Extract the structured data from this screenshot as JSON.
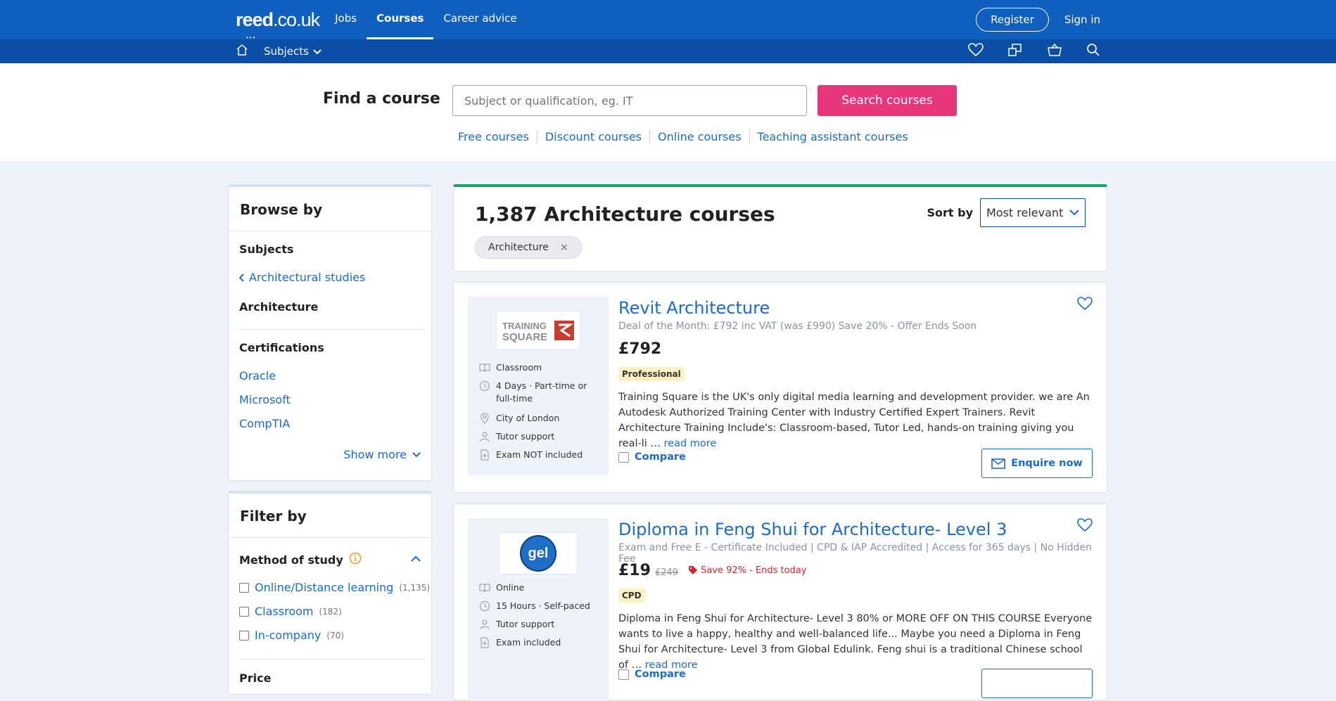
{
  "header": {
    "logo": "reed.co.uk",
    "nav": [
      "Jobs",
      "Courses",
      "Career advice"
    ],
    "register": "Register",
    "signin": "Sign in"
  },
  "subnav": {
    "subjects": "Subjects"
  },
  "search": {
    "label": "Find a course",
    "placeholder": "Subject or qualification, eg. IT",
    "button": "Search courses",
    "quicklinks": [
      "Free courses",
      "Discount courses",
      "Online courses",
      "Teaching assistant courses"
    ]
  },
  "browse": {
    "title": "Browse by",
    "subjects_head": "Subjects",
    "parent_link": "Architectural studies",
    "current": "Architecture",
    "cert_head": "Certifications",
    "certs": [
      "Oracle",
      "Microsoft",
      "CompTIA"
    ],
    "show_more": "Show more"
  },
  "filter": {
    "title": "Filter by",
    "method_head": "Method of study",
    "methods": [
      {
        "label": "Online/Distance learning",
        "count": "(1,135)"
      },
      {
        "label": "Classroom",
        "count": "(182)"
      },
      {
        "label": "In-company",
        "count": "(70)"
      }
    ],
    "price_head": "Price"
  },
  "results": {
    "count": "1,387 Architecture courses",
    "sort_label": "Sort by",
    "sort_value": "Most relevant",
    "chip": "Architecture"
  },
  "courses": [
    {
      "title": "Revit Architecture",
      "subtitle": "Deal of the Month: £792 inc VAT (was £990) Save 20% - Offer Ends Soon",
      "price": "£792",
      "badge": "Professional",
      "provider_logo": "TRAINING SQUARE",
      "features": [
        "Classroom",
        "4 Days · Part-time or full-time",
        "City of London",
        "Tutor support",
        "Exam NOT included"
      ],
      "desc": "Training Square is the UK's only digital media learning and development provider. we are An Autodesk Authorized Training Center with Industry Certified Expert Trainers. Revit Architecture Training Include's: Classroom-based, Tutor Led, hands-on training giving you real-li …",
      "read_more": "read more",
      "compare": "Compare",
      "enquire": "Enquire now"
    },
    {
      "title": "Diploma in Feng Shui for Architecture- Level 3",
      "subtitle": "Exam and Free E - Certificate Included | CPD & IAP Accredited | Access for 365 days | No Hidden Fee",
      "price": "£19",
      "old_price": "£249",
      "save": "Save 92% - Ends today",
      "badge": "CPD",
      "provider_logo": "gel",
      "features": [
        "Online",
        "15 Hours · Self-paced",
        "Tutor support",
        "Exam included"
      ],
      "desc": "Diploma in Feng Shui for Architecture- Level 3 80% or MORE OFF ON THIS COURSE Everyone wants to live a happy, healthy and well-balanced life... Maybe you need a Diploma in Feng Shui for Architecture- Level 3 from Global Edulink. Feng shui is a traditional Chinese school of …",
      "read_more": "read more",
      "compare": "Compare"
    }
  ],
  "colors": {
    "brand": "#0e5fbe",
    "accent": "#e8367d",
    "link": "#1a6bd0"
  }
}
